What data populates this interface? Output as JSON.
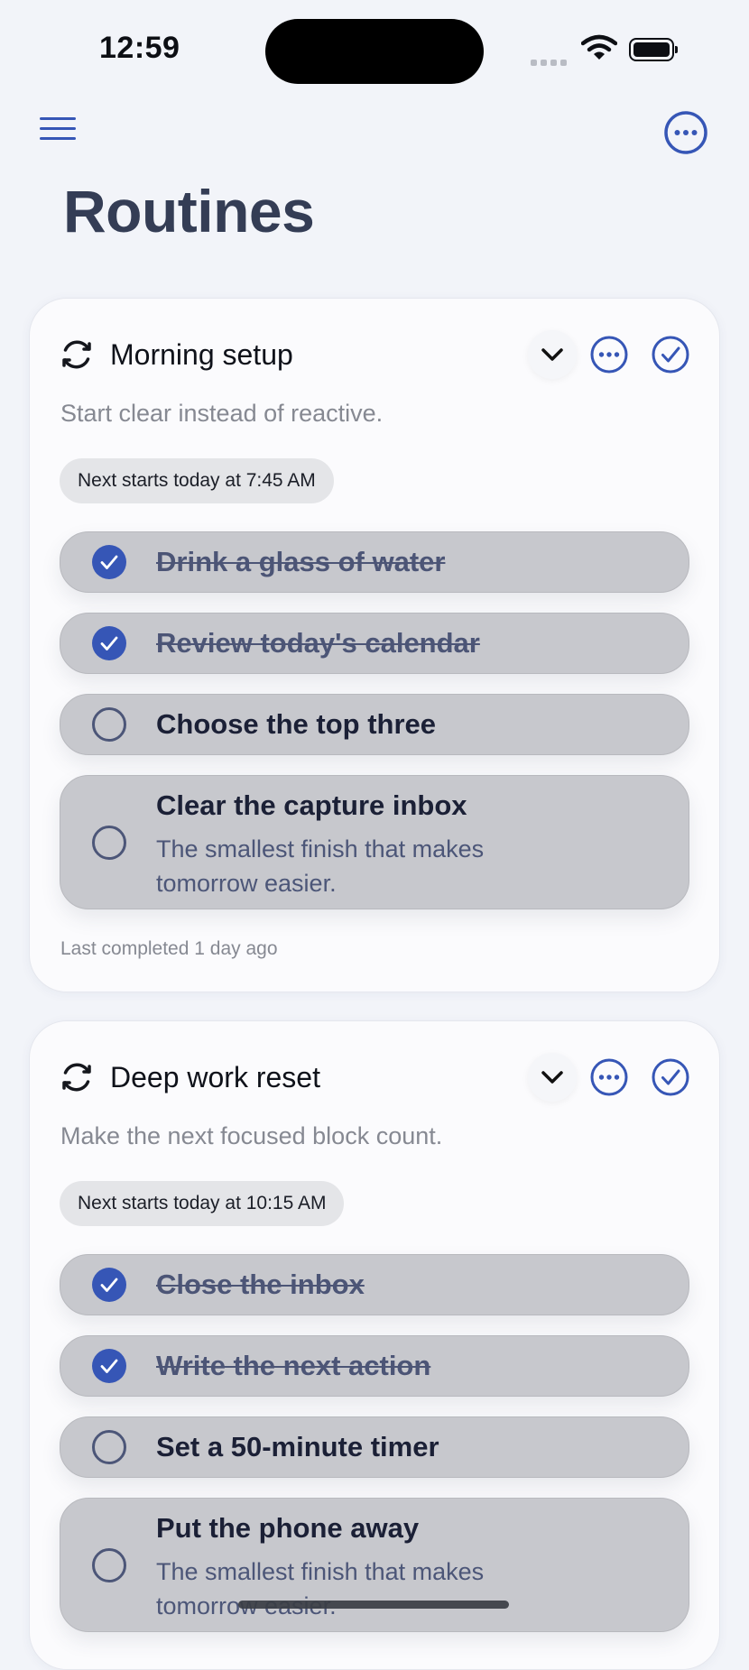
{
  "status_bar": {
    "time": "12:59"
  },
  "header": {
    "title": "Routines"
  },
  "colors": {
    "accent": "#3656b6",
    "step_background": "#c7c8cd",
    "card_background": "#fbfbfd"
  },
  "routines": [
    {
      "title": "Morning setup",
      "subtitle": "Start clear instead of reactive.",
      "next_start": "Next starts today at 7:45 AM",
      "steps": [
        {
          "label": "Drink a glass of water",
          "done": true
        },
        {
          "label": "Review today's calendar",
          "done": true
        },
        {
          "label": "Choose the top three",
          "done": false
        },
        {
          "label": "Clear the capture inbox",
          "note_line1": "The smallest finish that makes",
          "note_line2": "tomorrow easier.",
          "done": false
        }
      ],
      "last_completed": "Last completed 1 day ago"
    },
    {
      "title": "Deep work reset",
      "subtitle": "Make the next focused block count.",
      "next_start": "Next starts today at 10:15 AM",
      "steps": [
        {
          "label": "Close the inbox",
          "done": true
        },
        {
          "label": "Write the next action",
          "done": true
        },
        {
          "label": "Set a 50-minute timer",
          "done": false
        },
        {
          "label": "Put the phone away",
          "note_line1": "The smallest finish that makes",
          "note_line2": "tomorrow easier.",
          "done": false
        }
      ]
    }
  ]
}
